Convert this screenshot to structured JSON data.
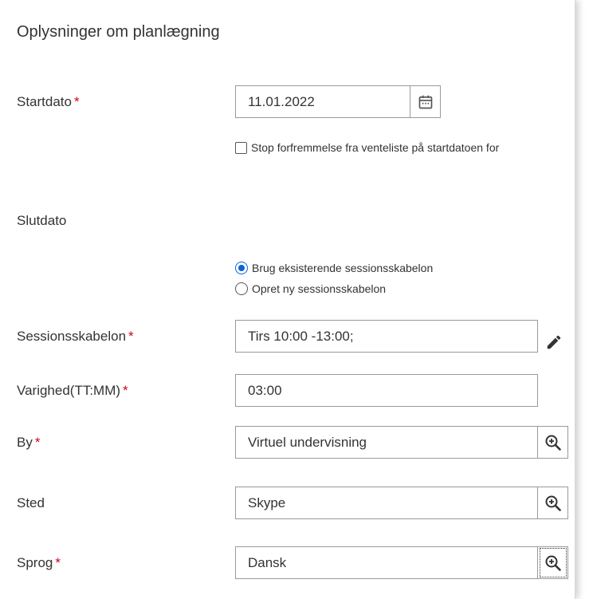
{
  "section": {
    "title": "Oplysninger om planlægning"
  },
  "required_marker": "*",
  "start_date": {
    "label": "Startdato",
    "value": "11.01.2022"
  },
  "stop_promotion": {
    "label": "Stop forfremmelse fra venteliste på startdatoen for",
    "checked": false
  },
  "end_date": {
    "label": "Slutdato"
  },
  "template_choice": {
    "options": [
      {
        "label": "Brug eksisterende sessionsskabelon",
        "selected": true
      },
      {
        "label": "Opret ny sessionsskabelon",
        "selected": false
      }
    ]
  },
  "session_template": {
    "label": "Sessionsskabelon",
    "value": "Tirs 10:00 -13:00;"
  },
  "duration": {
    "label": "Varighed(TT:MM)",
    "value": "03:00"
  },
  "city": {
    "label": "By",
    "value": "Virtuel undervisning"
  },
  "place": {
    "label": "Sted",
    "value": "Skype"
  },
  "language": {
    "label": "Sprog",
    "value": "Dansk"
  },
  "colors": {
    "required": "#d0021b",
    "radio_accent": "#0a64d8",
    "border": "#9a9a9a",
    "text": "#333333"
  },
  "icons": {
    "calendar": "calendar-icon",
    "edit": "pencil-icon",
    "lookup": "zoom-in-icon"
  }
}
